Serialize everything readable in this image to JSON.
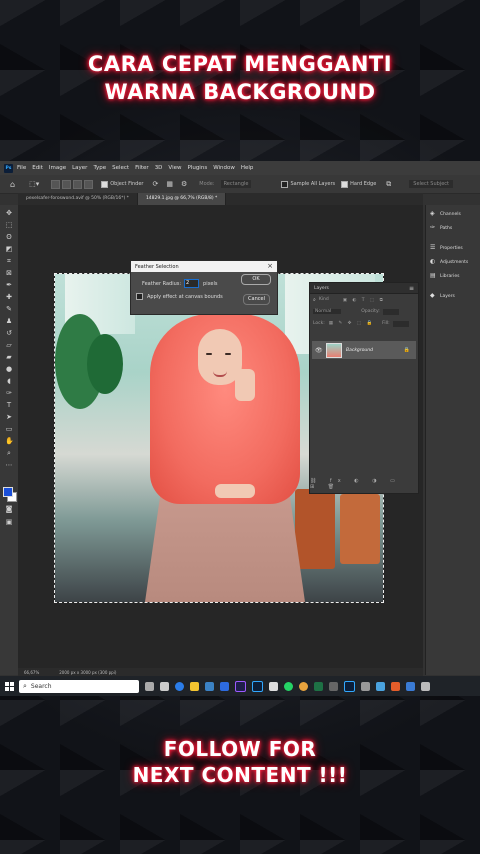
{
  "overlay": {
    "title_line1": "CARA CEPAT MENGGANTI",
    "title_line2": "WARNA BACKGROUND",
    "footer_line1": "FOLLOW FOR",
    "footer_line2": "NEXT CONTENT !!!"
  },
  "app": {
    "logo": "Ps",
    "menu": [
      "File",
      "Edit",
      "Image",
      "Layer",
      "Type",
      "Select",
      "Filter",
      "3D",
      "View",
      "Plugins",
      "Window",
      "Help"
    ]
  },
  "options_bar": {
    "object_finder": "Object Finder",
    "mode": "Mode:",
    "mode_value": "Rectangle",
    "sample_all_layers": "Sample All Layers",
    "hard_edge": "Hard Edge",
    "select_subject": "Select Subject"
  },
  "tabs": [
    {
      "label": "pexelsafer-foroswond.avif @ 50% (RGB/16*) *"
    },
    {
      "label": "14829.1.jpg @ 66,7% (RGB/8) *"
    }
  ],
  "dialog": {
    "title": "Feather Selection",
    "radius_label": "Feather Radius:",
    "radius_value": "2",
    "unit": "pixels",
    "checkbox_label": "Apply effect at canvas bounds",
    "ok_label": "OK",
    "cancel_label": "Cancel"
  },
  "layers_panel": {
    "title": "Layers",
    "kind_label": "Kind",
    "mode_label": "Normal",
    "opacity_label": "Opacity:",
    "lock_label": "Lock:",
    "fill_label": "Fill:",
    "layer_name": "Background"
  },
  "right_panel": {
    "items": [
      "Channels",
      "Paths",
      "Properties",
      "Adjustments",
      "Libraries",
      "Layers"
    ]
  },
  "status": {
    "zoom": "66,67%",
    "doc_size": "2000 px x 3000 px (300 ppi)"
  },
  "taskbar": {
    "search_placeholder": "Search"
  },
  "colors": {
    "accent": "#31a8ff",
    "glow": "#ff1e3c"
  }
}
